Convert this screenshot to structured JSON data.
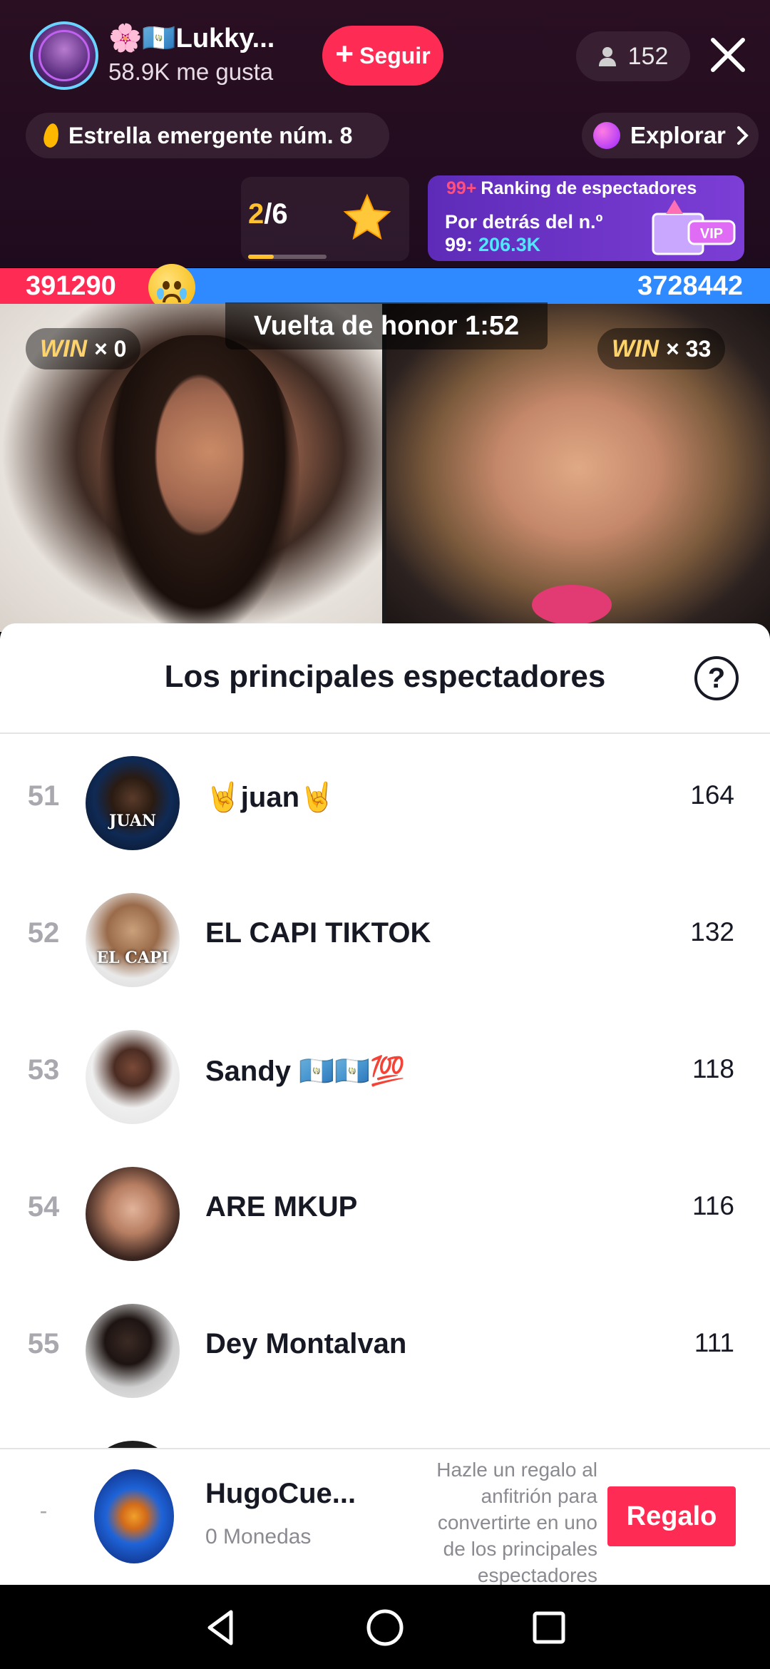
{
  "host": {
    "name": "🌸🇬🇹Lukky...",
    "likes": "58.9K me gusta",
    "follow_label": "Seguir",
    "avatar_icon": "profile-avatar"
  },
  "viewers": {
    "count": "152",
    "icon": "person-icon"
  },
  "badges": {
    "star": "Estrella emergente núm. 8",
    "explore": "Explorar"
  },
  "ranking": {
    "current": "2",
    "total": "/6",
    "vip_top_num": "99+",
    "vip_top_label": "Ranking de espectadores",
    "vip_line1": "Por detrás del n.º",
    "vip_line2_prefix": "99:",
    "vip_line2_value": "206.3K",
    "vip_badge": "VIP"
  },
  "battle": {
    "score_left": "391290",
    "score_right": "3728442",
    "honor": "Vuelta de honor 1:52",
    "win_left_label": "WIN",
    "win_left_count": "× 0",
    "win_right_label": "WIN",
    "win_right_count": "× 33",
    "colors": {
      "left": "#fe2c55",
      "right": "#2f89ff"
    }
  },
  "sheet": {
    "title": "Los principales espectadores",
    "help": "?",
    "rows": [
      {
        "rank": "51",
        "name": "🤘juan🤘",
        "score": "164",
        "tag": "JUAN"
      },
      {
        "rank": "52",
        "name": "EL CAPI TIKTOK",
        "score": "132",
        "tag": "EL CAPI"
      },
      {
        "rank": "53",
        "name": "Sandy 🇬🇹🇬🇹💯",
        "score": "118",
        "tag": ""
      },
      {
        "rank": "54",
        "name": "ARE MKUP",
        "score": "116",
        "tag": ""
      },
      {
        "rank": "55",
        "name": "Dey Montalvan",
        "score": "111",
        "tag": ""
      }
    ]
  },
  "footer": {
    "rank": "-",
    "name": "HugoCue...",
    "coins": "0 Monedas",
    "hint": "Hazle un regalo al anfitrión para convertirte en uno de los principales espectadores",
    "gift_label": "Regalo"
  }
}
